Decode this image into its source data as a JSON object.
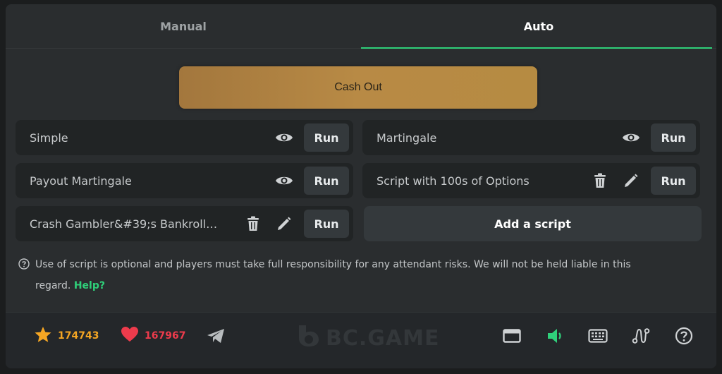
{
  "tabs": [
    {
      "label": "Manual",
      "active": false
    },
    {
      "label": "Auto",
      "active": true
    }
  ],
  "cashout": {
    "label": "Cash Out"
  },
  "scripts": [
    {
      "name": "Simple",
      "actions": [
        "eye-icon"
      ],
      "run_label": "Run"
    },
    {
      "name": "Martingale",
      "actions": [
        "eye-icon"
      ],
      "run_label": "Run"
    },
    {
      "name": "Payout Martingale",
      "actions": [
        "eye-icon"
      ],
      "run_label": "Run"
    },
    {
      "name": "Script with 100s of Options",
      "actions": [
        "trash-icon",
        "pencil-icon"
      ],
      "run_label": "Run"
    },
    {
      "name": "Crash Gambler&#39;s Bankroll…",
      "actions": [
        "trash-icon",
        "pencil-icon"
      ],
      "run_label": "Run"
    }
  ],
  "add_script": {
    "label": "Add a script"
  },
  "disclaimer": {
    "line1": "Use of script is optional and players must take full responsibility for any attendant risks. We will not be held liable in this",
    "line2": "regard.",
    "help": "Help?"
  },
  "footer": {
    "stars": "174743",
    "likes": "167967",
    "brand": "BC.GAME",
    "icons": [
      "star-icon",
      "heart-icon",
      "telegram-icon",
      "card-icon",
      "sound-icon",
      "keyboard-icon",
      "route-icon",
      "help-icon"
    ]
  },
  "colors": {
    "accent_green": "#2fd07a",
    "star_orange": "#f5a623",
    "heart_red": "#ed3b4c",
    "cashout_gold": "#b3863f"
  }
}
